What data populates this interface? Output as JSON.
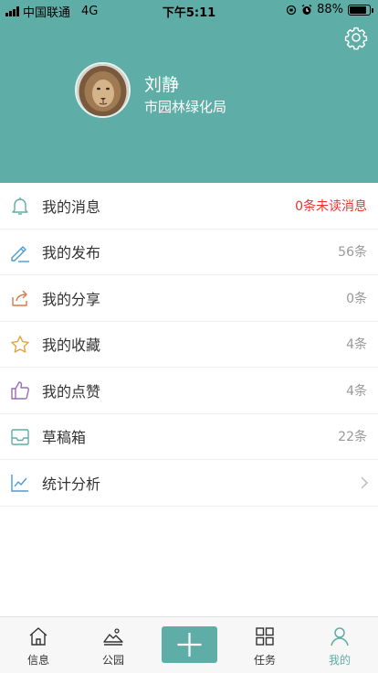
{
  "status_bar": {
    "carrier": "中国联通",
    "network": "4G",
    "time": "下午5:11",
    "battery": "88%",
    "battery_level": 0.88
  },
  "profile": {
    "name": "刘静",
    "organization": "市园林绿化局"
  },
  "menu": [
    {
      "label": "我的消息",
      "value": "0条未读消息",
      "icon": "bell-icon"
    },
    {
      "label": "我的发布",
      "value": "56条",
      "icon": "pencil-icon"
    },
    {
      "label": "我的分享",
      "value": "0条",
      "icon": "share-icon"
    },
    {
      "label": "我的收藏",
      "value": "4条",
      "icon": "star-icon"
    },
    {
      "label": "我的点赞",
      "value": "4条",
      "icon": "thumbs-up-icon"
    },
    {
      "label": "草稿箱",
      "value": "22条",
      "icon": "inbox-icon"
    },
    {
      "label": "统计分析",
      "value": "",
      "icon": "line-chart-icon"
    }
  ],
  "tabs": [
    {
      "label": "信息",
      "icon": "home-icon"
    },
    {
      "label": "公园",
      "icon": "mountain-icon"
    },
    {
      "label": "任务",
      "icon": "grid-icon"
    },
    {
      "label": "我的",
      "icon": "person-icon"
    }
  ],
  "colors": {
    "accent": "#5fada7",
    "alert": "#e8342f",
    "muted": "#999999"
  }
}
